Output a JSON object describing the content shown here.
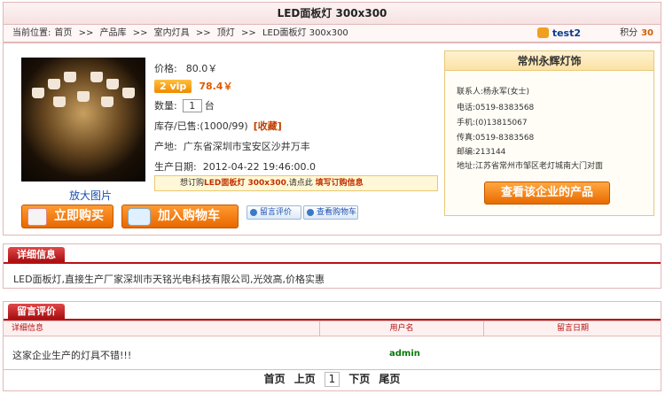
{
  "page": {
    "title": "LED面板灯  300x300"
  },
  "breadcrumb": {
    "prefix": "当前位置:",
    "items": [
      "首页",
      ">>",
      "产品库",
      ">>",
      "室内灯具",
      ">>",
      "顶灯",
      ">>",
      "LED面板灯  300x300"
    ]
  },
  "user": {
    "name": "test2",
    "points_label": "积分",
    "points": "30"
  },
  "product": {
    "zoom_link": "放大图片",
    "price_label": "价格:",
    "price": "80.0￥",
    "vip_badge": "2 vip",
    "vip_price": "78.4￥",
    "qty_label": "数量:",
    "qty_value": "1",
    "qty_unit": "台",
    "stock_label": "库存/已售:",
    "stock_value": "(1000/99)",
    "favorite": "[收藏]",
    "origin_label": "产地:",
    "origin_value": "广东省深圳市宝安区沙井万丰",
    "date_label": "生产日期:",
    "date_value": "2012-04-22 19:46:00.0",
    "order_prefix": "想订购",
    "order_item": "LED面板灯  300x300",
    "order_mid": ",请点此",
    "order_link": "填写订购信息",
    "buy_button": "立即购买",
    "cart_button": "加入购物车",
    "comment_button": "留言评价",
    "view_cart_button": "查看购物车"
  },
  "company": {
    "name": "常州永辉灯饰",
    "contact_label": "联系人:",
    "contact": "杨永军(女士)",
    "phone_label": "电话:",
    "phone": "0519-8383568",
    "mobile_label": "手机:",
    "mobile": "(0)13815067",
    "fax_label": "传真:",
    "fax": "0519-8383568",
    "zip_label": "邮编:",
    "zip": "213144",
    "address_label": "地址:",
    "address": "江苏省常州市邹区老灯城南大门对面",
    "products_button": "查看该企业的产品"
  },
  "details": {
    "tab": "详细信息",
    "text": "LED面板灯,直接生产厂家深圳市天铭光电科技有限公司,光效高,价格实惠"
  },
  "comments": {
    "tab": "留言评价",
    "headers": [
      "详细信息",
      "用户名",
      "留言日期"
    ],
    "rows": [
      {
        "text": "这家企业生产的灯具不错!!!",
        "user": "admin",
        "date": ""
      }
    ],
    "pager": {
      "first": "首页",
      "prev": "上页",
      "current": "1",
      "next": "下页",
      "last": "尾页"
    }
  },
  "colors": {
    "accent": "#e86800",
    "tab_red": "#b81214",
    "link_blue": "#1a4fb0",
    "user_green": "#0a7a0a"
  }
}
